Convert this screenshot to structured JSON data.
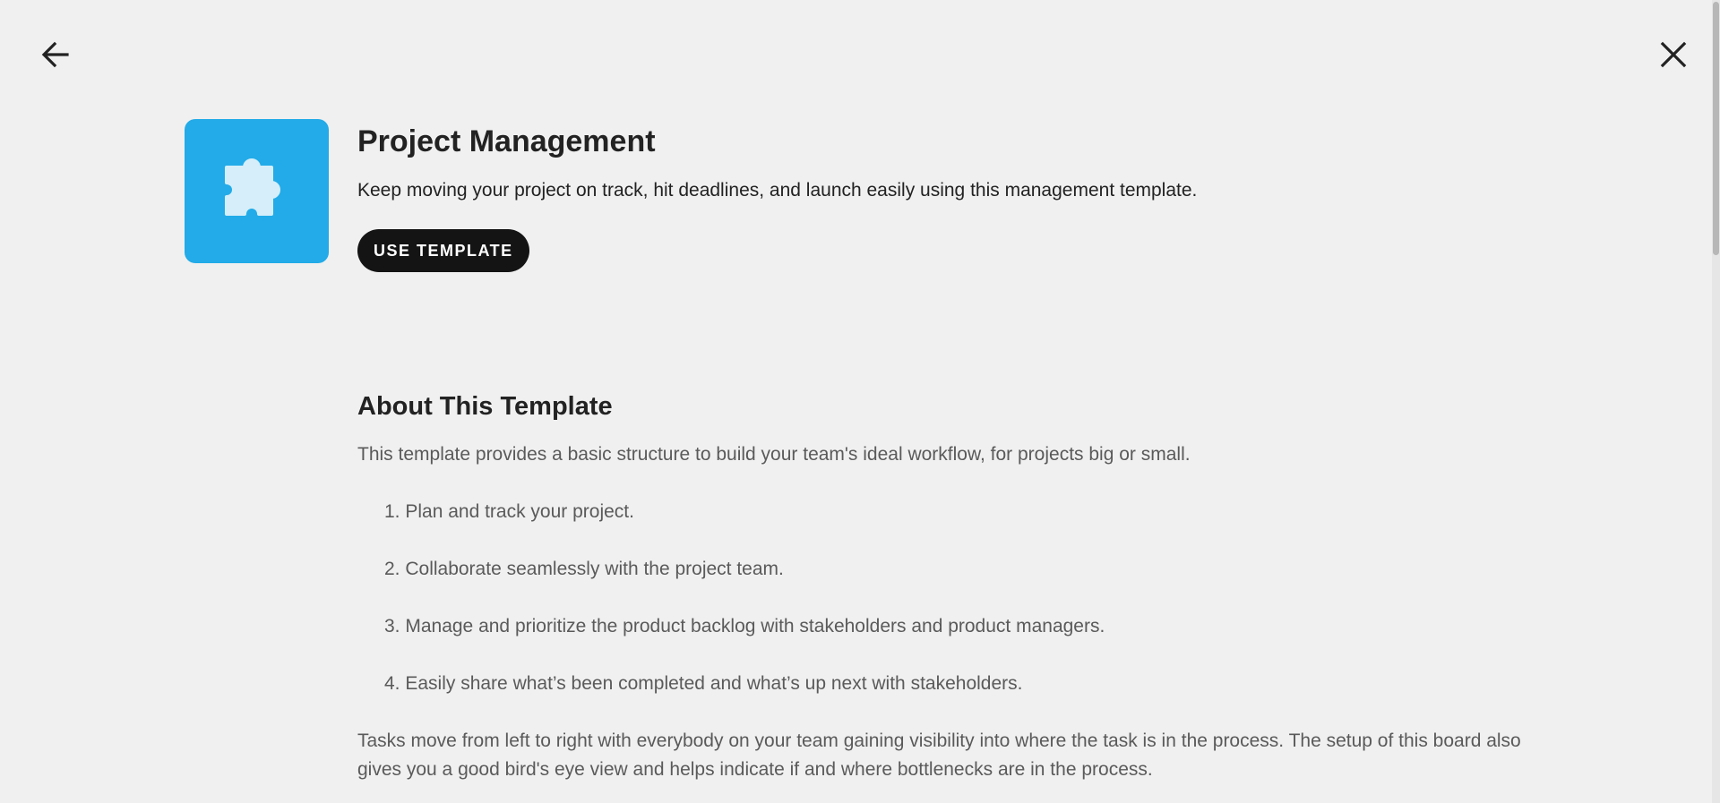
{
  "nav": {
    "back_icon": "arrow-left-icon",
    "close_icon": "close-icon"
  },
  "template": {
    "icon": "puzzle-piece-icon",
    "icon_bg_color": "#22abe8",
    "title": "Project Management",
    "description": "Keep moving your project on track, hit deadlines, and launch easily using this management template.",
    "cta_label": "USE TEMPLATE"
  },
  "about": {
    "heading": "About This Template",
    "intro": "This template provides a basic structure to build your team's ideal workflow, for projects big or small.",
    "items": [
      "1. Plan and track your project.",
      "2. Collaborate seamlessly with the project team.",
      "3. Manage and prioritize the product backlog with stakeholders and product managers.",
      "4. Easily share what’s been completed and what’s up next with stakeholders."
    ],
    "outro": "Tasks move from left to right with everybody on your team gaining visibility into where the task is in the process. The setup of this board also gives you a good bird's eye view and helps indicate if and where bottlenecks are in the process."
  }
}
